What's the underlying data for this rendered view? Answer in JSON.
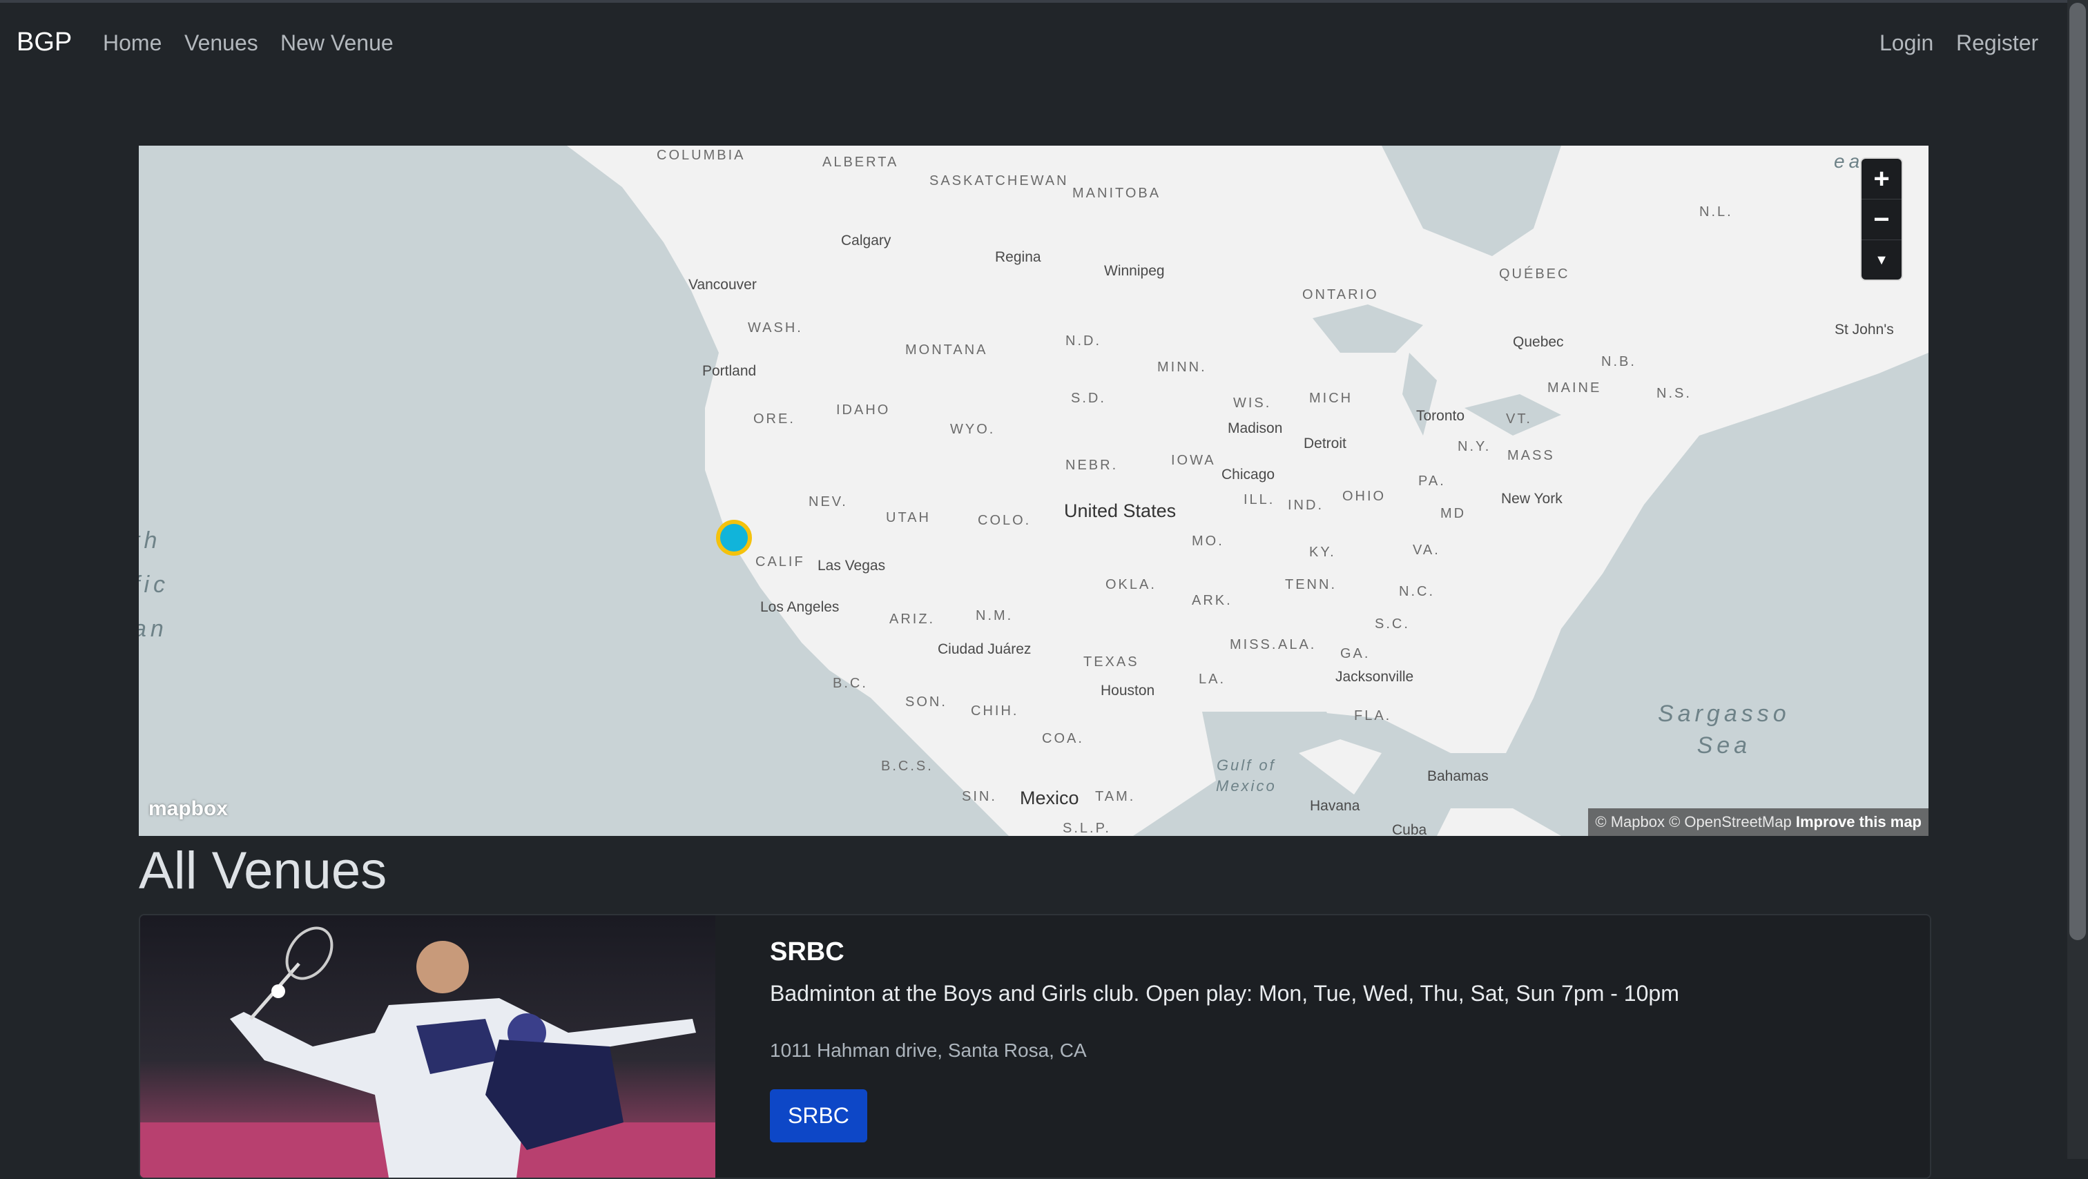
{
  "navbar": {
    "brand": "BGP",
    "links": [
      "Home",
      "Venues",
      "New Venue"
    ],
    "auth_links": [
      "Login",
      "Register"
    ]
  },
  "map": {
    "region_labels": [
      "COLUMBIA",
      "ALBERTA",
      "SASKATCHEWAN",
      "MANITOBA",
      "ONTARIO",
      "QUÉBEC",
      "N.L.",
      "WASH.",
      "MONTANA",
      "N.D.",
      "MINN.",
      "ORE.",
      "IDAHO",
      "WYO.",
      "S.D.",
      "WIS.",
      "MICH",
      "IOWA",
      "NEBR.",
      "NEV.",
      "UTAH",
      "COLO.",
      "ILL.",
      "IND.",
      "OHIO",
      "PA.",
      "N.Y.",
      "VT.",
      "MAINE",
      "MASS",
      "N.B.",
      "N.S.",
      "CALIF",
      "ARIZ.",
      "N.M.",
      "OKLA.",
      "MO.",
      "KY.",
      "VA.",
      "TENN.",
      "N.C.",
      "ARK.",
      "S.C.",
      "MISS.",
      "ALA.",
      "GA.",
      "TEXAS",
      "LA.",
      "FLA.",
      "B.C.",
      "SON.",
      "CHIH.",
      "COA.",
      "B.C.S.",
      "SIN.",
      "TAM.",
      "S.L.P.",
      "MD"
    ],
    "cities": [
      "Calgary",
      "Regina",
      "Winnipeg",
      "Vancouver",
      "Portland",
      "Quebec",
      "St John's",
      "Toronto",
      "Madison",
      "Detroit",
      "Chicago",
      "New York",
      "Las Vegas",
      "Los Angeles",
      "Ciudad Juárez",
      "Houston",
      "Jacksonville",
      "Bahamas",
      "Havana",
      "Cuba"
    ],
    "country_labels": [
      "United States",
      "Mexico"
    ],
    "ocean_labels": [
      "Gulf of\nMexico",
      "Sargasso\nSea"
    ],
    "ocean_partial": "th\nfic\nan",
    "ocean_corner": "ea",
    "zoom_in": "+",
    "zoom_out": "−",
    "compass": "▼",
    "logo": "mapbox",
    "attribution": "© Mapbox © OpenStreetMap",
    "improve_link": "Improve this map"
  },
  "page": {
    "title": "All Venues"
  },
  "venues": [
    {
      "title": "SRBC",
      "description": "Badminton at the Boys and Girls club. Open play: Mon, Tue, Wed, Thu, Sat, Sun 7pm - 10pm",
      "address": "1011 Hahman drive, Santa Rosa, CA",
      "button": "SRBC"
    }
  ],
  "colors": {
    "background": "#212529",
    "marker_fill": "#11b4da",
    "marker_ring": "#f4c20d",
    "button": "#0d47c7"
  }
}
